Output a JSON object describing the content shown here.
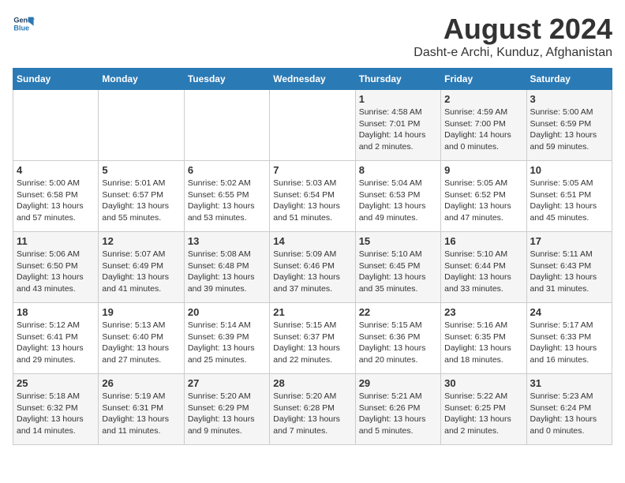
{
  "header": {
    "logo_line1": "General",
    "logo_line2": "Blue",
    "title": "August 2024",
    "subtitle": "Dasht-e Archi, Kunduz, Afghanistan"
  },
  "calendar": {
    "days_of_week": [
      "Sunday",
      "Monday",
      "Tuesday",
      "Wednesday",
      "Thursday",
      "Friday",
      "Saturday"
    ],
    "weeks": [
      [
        {
          "day": "",
          "info": ""
        },
        {
          "day": "",
          "info": ""
        },
        {
          "day": "",
          "info": ""
        },
        {
          "day": "",
          "info": ""
        },
        {
          "day": "1",
          "info": "Sunrise: 4:58 AM\nSunset: 7:01 PM\nDaylight: 14 hours\nand 2 minutes."
        },
        {
          "day": "2",
          "info": "Sunrise: 4:59 AM\nSunset: 7:00 PM\nDaylight: 14 hours\nand 0 minutes."
        },
        {
          "day": "3",
          "info": "Sunrise: 5:00 AM\nSunset: 6:59 PM\nDaylight: 13 hours\nand 59 minutes."
        }
      ],
      [
        {
          "day": "4",
          "info": "Sunrise: 5:00 AM\nSunset: 6:58 PM\nDaylight: 13 hours\nand 57 minutes."
        },
        {
          "day": "5",
          "info": "Sunrise: 5:01 AM\nSunset: 6:57 PM\nDaylight: 13 hours\nand 55 minutes."
        },
        {
          "day": "6",
          "info": "Sunrise: 5:02 AM\nSunset: 6:55 PM\nDaylight: 13 hours\nand 53 minutes."
        },
        {
          "day": "7",
          "info": "Sunrise: 5:03 AM\nSunset: 6:54 PM\nDaylight: 13 hours\nand 51 minutes."
        },
        {
          "day": "8",
          "info": "Sunrise: 5:04 AM\nSunset: 6:53 PM\nDaylight: 13 hours\nand 49 minutes."
        },
        {
          "day": "9",
          "info": "Sunrise: 5:05 AM\nSunset: 6:52 PM\nDaylight: 13 hours\nand 47 minutes."
        },
        {
          "day": "10",
          "info": "Sunrise: 5:05 AM\nSunset: 6:51 PM\nDaylight: 13 hours\nand 45 minutes."
        }
      ],
      [
        {
          "day": "11",
          "info": "Sunrise: 5:06 AM\nSunset: 6:50 PM\nDaylight: 13 hours\nand 43 minutes."
        },
        {
          "day": "12",
          "info": "Sunrise: 5:07 AM\nSunset: 6:49 PM\nDaylight: 13 hours\nand 41 minutes."
        },
        {
          "day": "13",
          "info": "Sunrise: 5:08 AM\nSunset: 6:48 PM\nDaylight: 13 hours\nand 39 minutes."
        },
        {
          "day": "14",
          "info": "Sunrise: 5:09 AM\nSunset: 6:46 PM\nDaylight: 13 hours\nand 37 minutes."
        },
        {
          "day": "15",
          "info": "Sunrise: 5:10 AM\nSunset: 6:45 PM\nDaylight: 13 hours\nand 35 minutes."
        },
        {
          "day": "16",
          "info": "Sunrise: 5:10 AM\nSunset: 6:44 PM\nDaylight: 13 hours\nand 33 minutes."
        },
        {
          "day": "17",
          "info": "Sunrise: 5:11 AM\nSunset: 6:43 PM\nDaylight: 13 hours\nand 31 minutes."
        }
      ],
      [
        {
          "day": "18",
          "info": "Sunrise: 5:12 AM\nSunset: 6:41 PM\nDaylight: 13 hours\nand 29 minutes."
        },
        {
          "day": "19",
          "info": "Sunrise: 5:13 AM\nSunset: 6:40 PM\nDaylight: 13 hours\nand 27 minutes."
        },
        {
          "day": "20",
          "info": "Sunrise: 5:14 AM\nSunset: 6:39 PM\nDaylight: 13 hours\nand 25 minutes."
        },
        {
          "day": "21",
          "info": "Sunrise: 5:15 AM\nSunset: 6:37 PM\nDaylight: 13 hours\nand 22 minutes."
        },
        {
          "day": "22",
          "info": "Sunrise: 5:15 AM\nSunset: 6:36 PM\nDaylight: 13 hours\nand 20 minutes."
        },
        {
          "day": "23",
          "info": "Sunrise: 5:16 AM\nSunset: 6:35 PM\nDaylight: 13 hours\nand 18 minutes."
        },
        {
          "day": "24",
          "info": "Sunrise: 5:17 AM\nSunset: 6:33 PM\nDaylight: 13 hours\nand 16 minutes."
        }
      ],
      [
        {
          "day": "25",
          "info": "Sunrise: 5:18 AM\nSunset: 6:32 PM\nDaylight: 13 hours\nand 14 minutes."
        },
        {
          "day": "26",
          "info": "Sunrise: 5:19 AM\nSunset: 6:31 PM\nDaylight: 13 hours\nand 11 minutes."
        },
        {
          "day": "27",
          "info": "Sunrise: 5:20 AM\nSunset: 6:29 PM\nDaylight: 13 hours\nand 9 minutes."
        },
        {
          "day": "28",
          "info": "Sunrise: 5:20 AM\nSunset: 6:28 PM\nDaylight: 13 hours\nand 7 minutes."
        },
        {
          "day": "29",
          "info": "Sunrise: 5:21 AM\nSunset: 6:26 PM\nDaylight: 13 hours\nand 5 minutes."
        },
        {
          "day": "30",
          "info": "Sunrise: 5:22 AM\nSunset: 6:25 PM\nDaylight: 13 hours\nand 2 minutes."
        },
        {
          "day": "31",
          "info": "Sunrise: 5:23 AM\nSunset: 6:24 PM\nDaylight: 13 hours\nand 0 minutes."
        }
      ]
    ]
  }
}
